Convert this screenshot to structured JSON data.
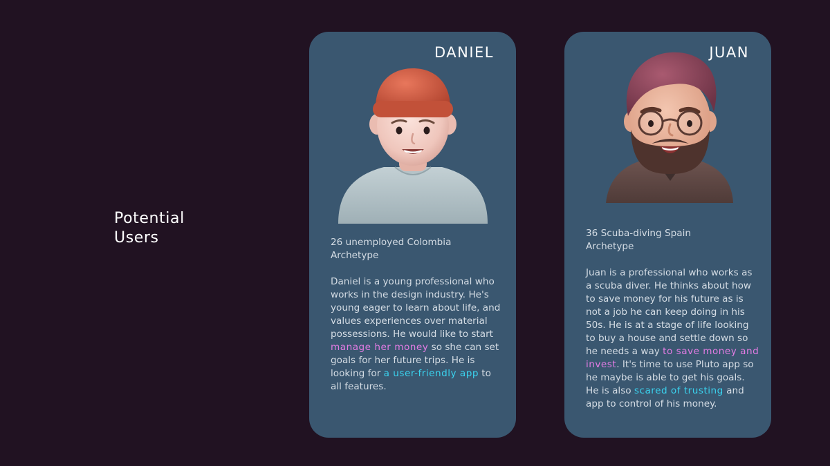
{
  "heading": {
    "line1": "Potential",
    "line2": "Users"
  },
  "cards": [
    {
      "name": "DANIEL",
      "meta_line1": "26 unemployed Colombia",
      "meta_line2": "Archetype",
      "desc_part1": "Daniel is a young professional who works in the design industry. He's young eager to learn about life, and values experiences over material possessions. He would like to start ",
      "desc_highlight1": "manage her money",
      "desc_part2": " so she can set goals for her future trips. He is looking for ",
      "desc_highlight2": "a user-friendly app",
      "desc_part3": " to all features.",
      "avatar": "avatar-young-man-orange-beanie"
    },
    {
      "name": "JUAN",
      "meta_line1": "36 Scuba-diving Spain",
      "meta_line2": "Archetype",
      "desc_part1": "Juan is a professional who works as a scuba diver. He thinks about how to save money for his future as is not a job he can keep doing in his 50s. He is at a stage of life looking to buy a house and settle down so he needs a way ",
      "desc_highlight1": "to save money and invest",
      "desc_part2": ". It's time to use Pluto app so he maybe is able to get his goals. He is also ",
      "desc_highlight2": "scared of trusting",
      "desc_part3": " and app to control of his money.",
      "avatar": "avatar-bearded-man-glasses"
    }
  ],
  "colors": {
    "background": "#211222",
    "card": "#3a5770",
    "highlight_pink": "#e37ce4",
    "highlight_cyan": "#3ad3ef"
  }
}
